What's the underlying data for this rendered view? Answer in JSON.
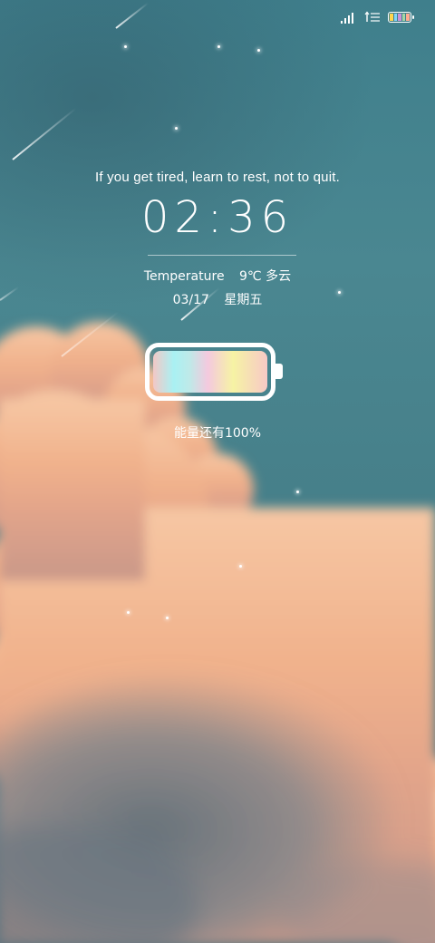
{
  "status_bar": {
    "signal_icon": "signal-bars-icon",
    "data_icon": "network-arrows-icon",
    "battery_icon": "battery-icon",
    "battery_colors": [
      "#ffd54f",
      "#81d4fa",
      "#ce93d8",
      "#a5d6a7",
      "#ffab91"
    ]
  },
  "lockscreen": {
    "quote": "If you get tired, learn to rest, not to quit.",
    "time": "02:36",
    "temperature_label": "Temperature",
    "temperature_value": "9℃ 多云",
    "date": "03/17",
    "weekday": "星期五",
    "battery_graphic_icon": "gradient-battery-icon",
    "battery_level": 1.0,
    "energy_text": "能量还有100%"
  },
  "colors": {
    "sky": "#4a8791",
    "cloud_peach": "#f2b58f",
    "cloud_shadow": "#6a7d86"
  }
}
